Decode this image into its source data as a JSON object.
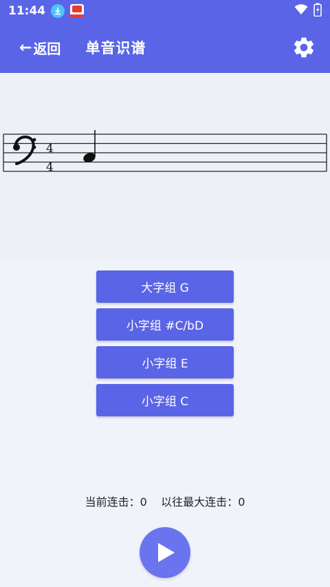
{
  "status_bar": {
    "time": "11:44",
    "icons": [
      "download-icon",
      "app-notification-icon",
      "wifi-icon",
      "battery-icon"
    ]
  },
  "app_bar": {
    "back_label": "返回",
    "title": "单音识谱",
    "settings_icon": "gear-icon"
  },
  "staff": {
    "clef": "bass",
    "time_signature": {
      "top": "4",
      "bottom": "4"
    },
    "note": "quarter-note"
  },
  "answers": [
    {
      "label": "大字组 G"
    },
    {
      "label": "小字组 #C/bD"
    },
    {
      "label": "小字组 E"
    },
    {
      "label": "小字组 C"
    }
  ],
  "stats": {
    "current_streak_label": "当前连击：",
    "current_streak_value": "0",
    "max_streak_label": "以往最大连击：",
    "max_streak_value": "0"
  },
  "colors": {
    "primary": "#5a64e6",
    "background": "#f1f3fb"
  }
}
